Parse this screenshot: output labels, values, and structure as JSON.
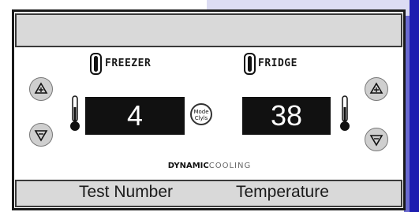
{
  "panel": {
    "freezer": {
      "title": "FREEZER",
      "display_value": "4"
    },
    "fridge": {
      "title": "FRIDGE",
      "display_value": "38"
    },
    "mode_button": {
      "line1": "Mode",
      "line2": "Clyls"
    },
    "brand": {
      "bold": "DYNAMIC",
      "light": "COOLING"
    }
  },
  "footer": {
    "left_label": "Test Number",
    "right_label": "Temperature"
  },
  "colors": {
    "display_bg": "#111111",
    "bar_gray": "#d9d9d9",
    "edge_blue": "#1d1db0",
    "lavender": "#dcdcf3"
  },
  "icons": [
    "door-icon",
    "thermometer-icon",
    "plus-arrow-icon",
    "minus-arrow-icon"
  ]
}
